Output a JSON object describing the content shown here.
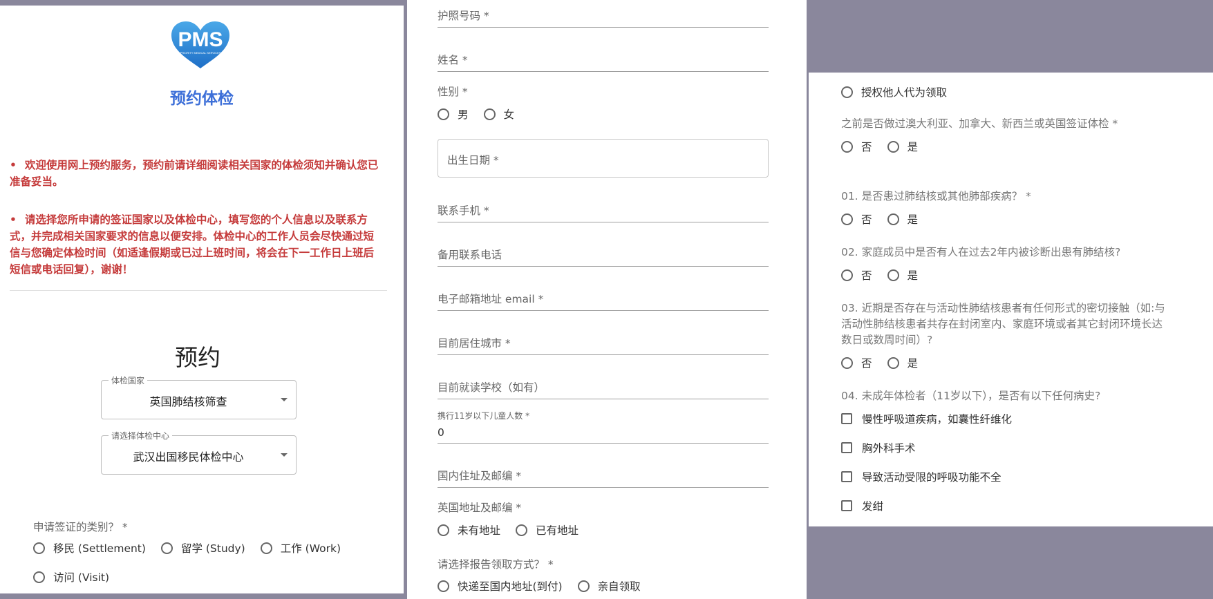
{
  "panel1": {
    "logo_text": "PMS",
    "logo_subtext": "PRIORITY MEDICAL SERVICES",
    "title": "预约体检",
    "notices": [
      "欢迎使用网上预约服务，预约前请详细阅读相关国家的体检须知并确认您已准备妥当。",
      "请选择您所申请的签证国家以及体检中心，填写您的个人信息以及联系方式，并完成相关国家要求的信息以便安排。体检中心的工作人员会尽快通过短信与您确定体检时间（如适逢假期或已过上班时间，将会在下一工作日上班后短信或电话回复），谢谢！"
    ],
    "section_title": "预约",
    "country_select": {
      "label": "体检国家",
      "value": "英国肺结核筛查"
    },
    "center_select": {
      "label": "请选择体检中心",
      "value": "武汉出国移民体检中心"
    },
    "visa_type": {
      "label": "申请签证的类别？ *",
      "options": [
        "移民 (Settlement)",
        "留学 (Study)",
        "工作 (Work)",
        "访问 (Visit)"
      ]
    }
  },
  "panel2": {
    "passport": "护照号码 *",
    "name": "姓名 *",
    "gender": {
      "label": "性别 *",
      "options": [
        "男",
        "女"
      ]
    },
    "dob": "出生日期 *",
    "mobile": "联系手机 *",
    "alt_phone": "备用联系电话",
    "email": "电子邮箱地址 email *",
    "city": "目前居住城市 *",
    "school": "目前就读学校（如有）",
    "children": {
      "label": "携行11岁以下儿童人数 *",
      "value": "0"
    },
    "domestic_address": "国内住址及邮编 *",
    "uk_address": {
      "label": "英国地址及邮编 *",
      "options": [
        "未有地址",
        "已有地址"
      ]
    },
    "report_method": {
      "label": "请选择报告领取方式？ *",
      "options": [
        "快递至国内地址(到付)",
        "亲自领取"
      ]
    }
  },
  "panel3": {
    "authorize_option": "授权他人代为领取",
    "prior_exam": {
      "label": "之前是否做过澳大利亚、加拿大、新西兰或英国签证体检 *",
      "options": [
        "否",
        "是"
      ]
    },
    "q1": {
      "label": "01. 是否患过肺结核或其他肺部疾病？ *",
      "options": [
        "否",
        "是"
      ]
    },
    "q2": {
      "label": "02. 家庭成员中是否有人在过去2年内被诊断出患有肺结核?",
      "options": [
        "否",
        "是"
      ]
    },
    "q3": {
      "label": "03. 近期是否存在与活动性肺结核患者有任何形式的密切接触（如:与活动性肺结核患者共存在封闭室内、家庭环境或者其它封闭环境长达数日或数周时间）?",
      "options": [
        "否",
        "是"
      ]
    },
    "q4": {
      "label": "04. 未成年体检者（11岁以下），是否有以下任何病史?",
      "checks": [
        "慢性呼吸道疾病，如囊性纤维化",
        "胸外科手术",
        "导致活动受限的呼吸功能不全",
        "发绀"
      ]
    }
  },
  "colors": {
    "brand_blue": "#3d6fd8",
    "notice_red": "#c53b3b",
    "backdrop": "#8a879c"
  }
}
